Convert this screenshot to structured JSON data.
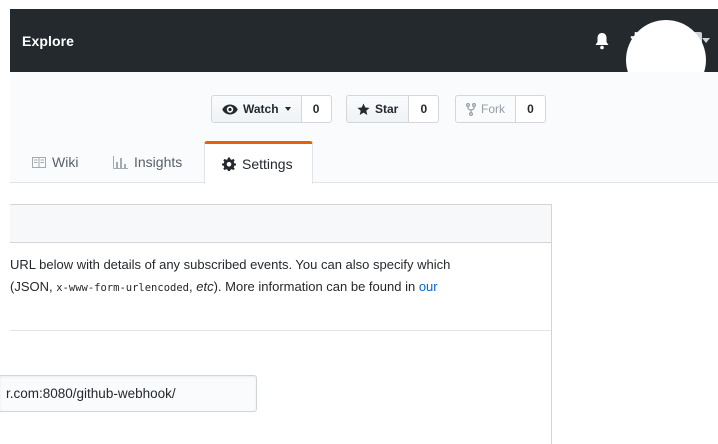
{
  "header": {
    "explore_label": "Explore",
    "plus_label": "+"
  },
  "repo_actions": {
    "watch": {
      "label": "Watch",
      "count": "0"
    },
    "star": {
      "label": "Star",
      "count": "0"
    },
    "fork": {
      "label": "Fork",
      "count": "0"
    }
  },
  "tabs": {
    "wiki": "Wiki",
    "insights": "Insights",
    "settings": "Settings"
  },
  "description": {
    "line1": "URL below with details of any subscribed events. You can also specify which",
    "line2_before": "(JSON, ",
    "line2_code": "x-www-form-urlencoded",
    "line2_mid": ", ",
    "line2_etc": "etc",
    "line2_after": "). More information can be found in ",
    "line2_link": "our"
  },
  "payload_url": {
    "value": "r.com:8080/github-webhook/"
  },
  "colors": {
    "header_bg": "#24292e",
    "active_tab_accent": "#e36209",
    "link": "#0366d6"
  }
}
